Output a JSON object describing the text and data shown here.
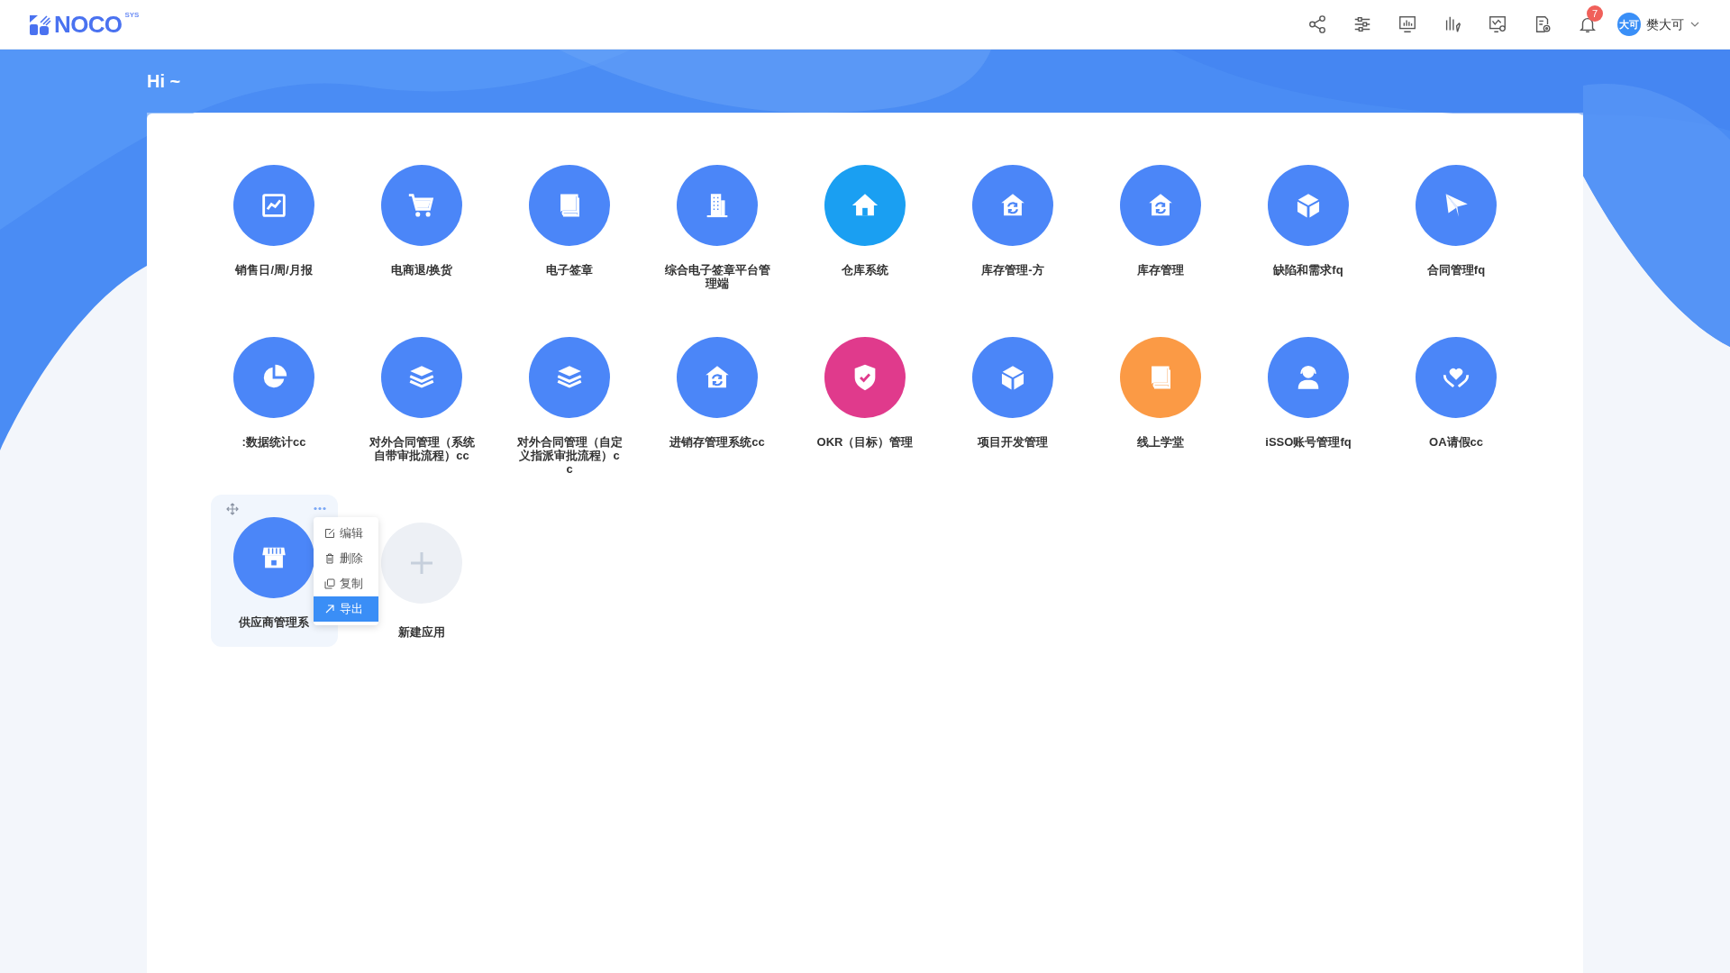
{
  "header": {
    "logo": {
      "text": "NOCO",
      "superscript": "SYS"
    },
    "notifications": {
      "badge": "7"
    },
    "user": {
      "avatar": "大可",
      "name": "樊大可"
    }
  },
  "greeting": "Hi ~",
  "apps": [
    {
      "label": "销售日/周/月报",
      "color": "#4b86f8",
      "hovered": false
    },
    {
      "label": "电商退/换货",
      "color": "#4b86f8",
      "hovered": false
    },
    {
      "label": "电子签章",
      "color": "#4b86f8",
      "hovered": false
    },
    {
      "label": "综合电子签章平台管理端",
      "color": "#4b86f8",
      "hovered": false
    },
    {
      "label": "仓库系统",
      "color": "#1a9ff2",
      "hovered": false
    },
    {
      "label": "库存管理-方",
      "color": "#4b86f8",
      "hovered": false
    },
    {
      "label": "库存管理",
      "color": "#4b86f8",
      "hovered": false
    },
    {
      "label": "缺陷和需求fq",
      "color": "#4b86f8",
      "hovered": false
    },
    {
      "label": "合同管理fq",
      "color": "#4b86f8",
      "hovered": false
    },
    {
      "label": ":数据统计cc",
      "color": "#4b86f8",
      "hovered": false
    },
    {
      "label": "对外合同管理（系统自带审批流程）cc",
      "color": "#4b86f8",
      "hovered": false
    },
    {
      "label": "对外合同管理（自定义指派审批流程）cc",
      "color": "#4b86f8",
      "hovered": false
    },
    {
      "label": "进销存管理系统cc",
      "color": "#4b86f8",
      "hovered": false
    },
    {
      "label": "OKR（目标）管理",
      "color": "#e03a8c",
      "hovered": false
    },
    {
      "label": "项目开发管理",
      "color": "#4b86f8",
      "hovered": false
    },
    {
      "label": "线上学堂",
      "color": "#fb9a45",
      "hovered": false
    },
    {
      "label": "iSSO账号管理fq",
      "color": "#4b86f8",
      "hovered": false
    },
    {
      "label": "OA请假cc",
      "color": "#4b86f8",
      "hovered": false
    },
    {
      "label": "供应商管理系",
      "color": "#4b86f8",
      "hovered": true,
      "menu": [
        {
          "label": "编辑",
          "selected": false
        },
        {
          "label": "删除",
          "selected": false
        },
        {
          "label": "复制",
          "selected": false
        },
        {
          "label": "导出",
          "selected": true
        }
      ]
    }
  ],
  "new_app": {
    "label": "新建应用"
  }
}
